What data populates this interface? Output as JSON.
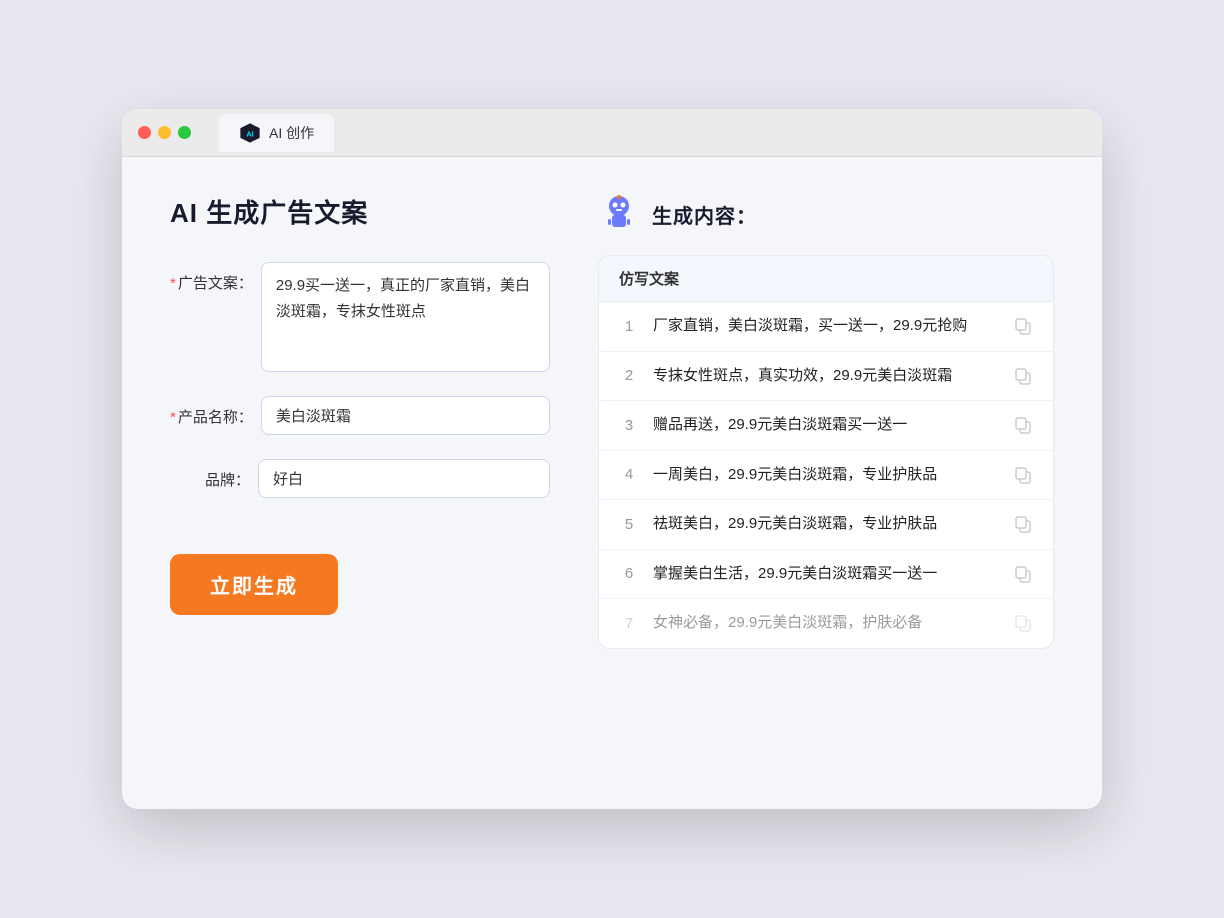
{
  "window": {
    "tab_label": "AI 创作"
  },
  "left": {
    "title": "AI 生成广告文案",
    "ad_text_label": "广告文案：",
    "ad_text_required": "*",
    "ad_text_value": "29.9买一送一，真正的厂家直销，美白淡斑霜，专抹女性斑点",
    "product_name_label": "产品名称：",
    "product_name_required": "*",
    "product_name_value": "美白淡斑霜",
    "brand_label": "品牌：",
    "brand_value": "好白",
    "generate_button": "立即生成"
  },
  "right": {
    "result_title": "生成内容：",
    "table_header": "仿写文案",
    "rows": [
      {
        "number": "1",
        "text": "厂家直销，美白淡斑霜，买一送一，29.9元抢购",
        "faded": false
      },
      {
        "number": "2",
        "text": "专抹女性斑点，真实功效，29.9元美白淡斑霜",
        "faded": false
      },
      {
        "number": "3",
        "text": "赠品再送，29.9元美白淡斑霜买一送一",
        "faded": false
      },
      {
        "number": "4",
        "text": "一周美白，29.9元美白淡斑霜，专业护肤品",
        "faded": false
      },
      {
        "number": "5",
        "text": "祛斑美白，29.9元美白淡斑霜，专业护肤品",
        "faded": false
      },
      {
        "number": "6",
        "text": "掌握美白生活，29.9元美白淡斑霜买一送一",
        "faded": false
      },
      {
        "number": "7",
        "text": "女神必备，29.9元美白淡斑霜，护肤必备",
        "faded": true
      }
    ]
  },
  "colors": {
    "accent_orange": "#f47920",
    "accent_blue": "#6b7aff",
    "required_red": "#ff4d4f"
  }
}
